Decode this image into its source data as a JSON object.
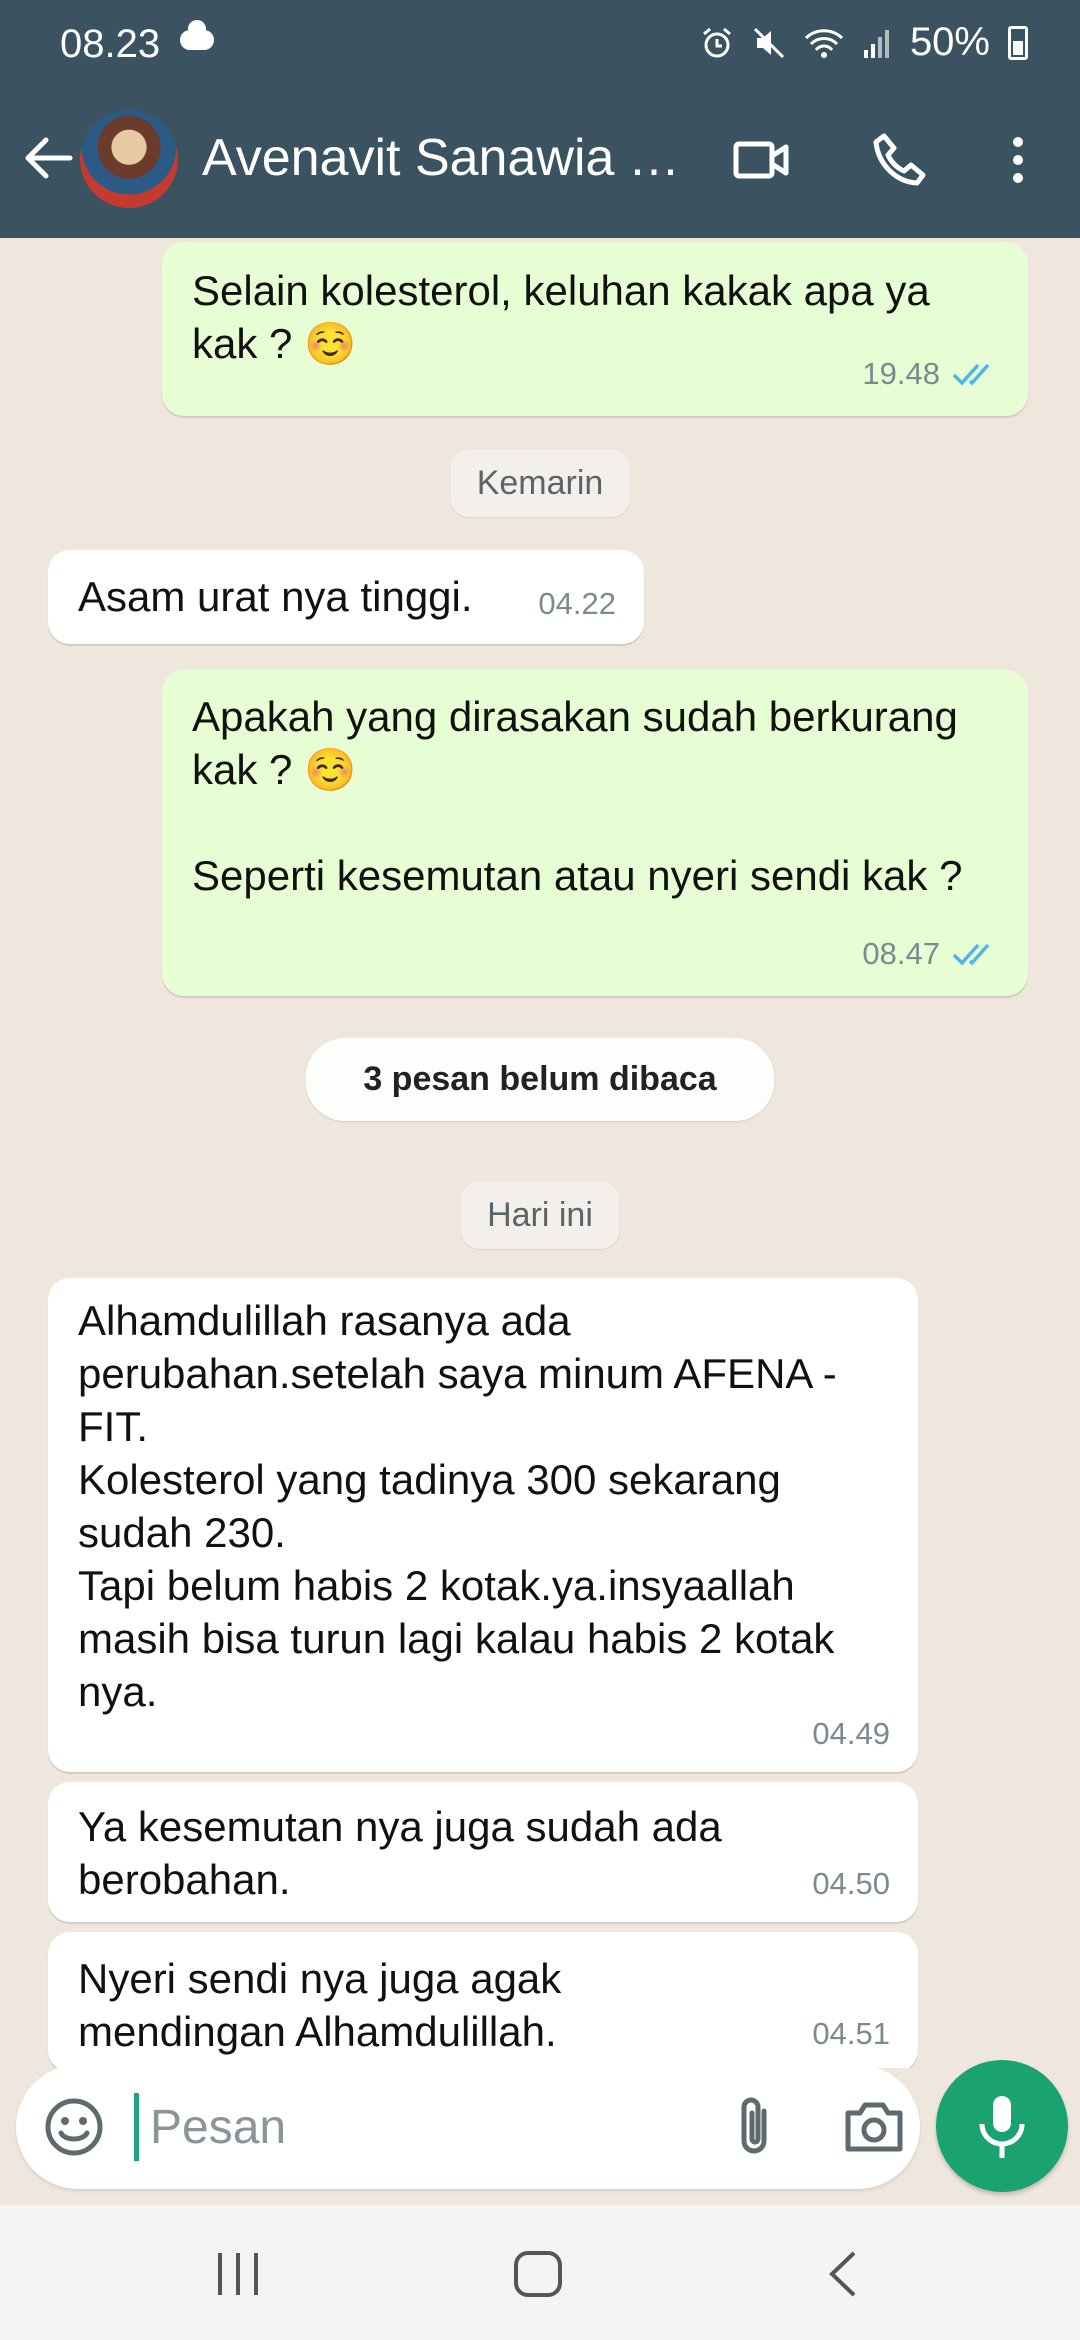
{
  "status_bar": {
    "time": "08.23",
    "battery": "50%"
  },
  "header": {
    "contact_name": "Avenavit Sanawia Y..."
  },
  "messages": [
    {
      "dir": "out",
      "text": "Selain kolesterol, keluhan kakak apa ya kak ? ☺️",
      "time": "19.48",
      "read": true
    },
    {
      "dir": "in",
      "text": "Asam urat nya tinggi.",
      "time": "04.22"
    },
    {
      "dir": "out",
      "text": "Apakah yang dirasakan sudah berkurang kak ? ☺️\n\nSeperti kesemutan atau nyeri sendi kak ?",
      "time": "08.47",
      "read": true
    },
    {
      "dir": "in",
      "text": "Alhamdulillah rasanya ada perubahan.setelah saya minum AFENA -FIT.\nKolesterol yang tadinya 300 sekarang sudah 230.\nTapi belum habis 2 kotak.ya.insyaallah masih bisa turun lagi kalau habis 2 kotak nya.",
      "time": "04.49"
    },
    {
      "dir": "in",
      "text": "Ya kesemutan nya juga sudah ada berobahan.",
      "time": "04.50"
    },
    {
      "dir": "in",
      "text": "Nyeri sendi nya juga agak mendingan Alhamdulillah.",
      "time": "04.51"
    }
  ],
  "date_pills": {
    "yesterday": "Kemarin",
    "today": "Hari ini"
  },
  "unread_banner": "3 pesan belum dibaca",
  "composer": {
    "placeholder": "Pesan"
  },
  "colors": {
    "header": "#3b5360",
    "outgoing": "#e7fdd3",
    "incoming": "#ffffff",
    "accent": "#1ba271",
    "read_tick": "#4fb6ec"
  },
  "icons": [
    "back-arrow-icon",
    "video-call-icon",
    "phone-icon",
    "more-options-icon",
    "emoji-icon",
    "attach-icon",
    "camera-icon",
    "mic-icon"
  ]
}
